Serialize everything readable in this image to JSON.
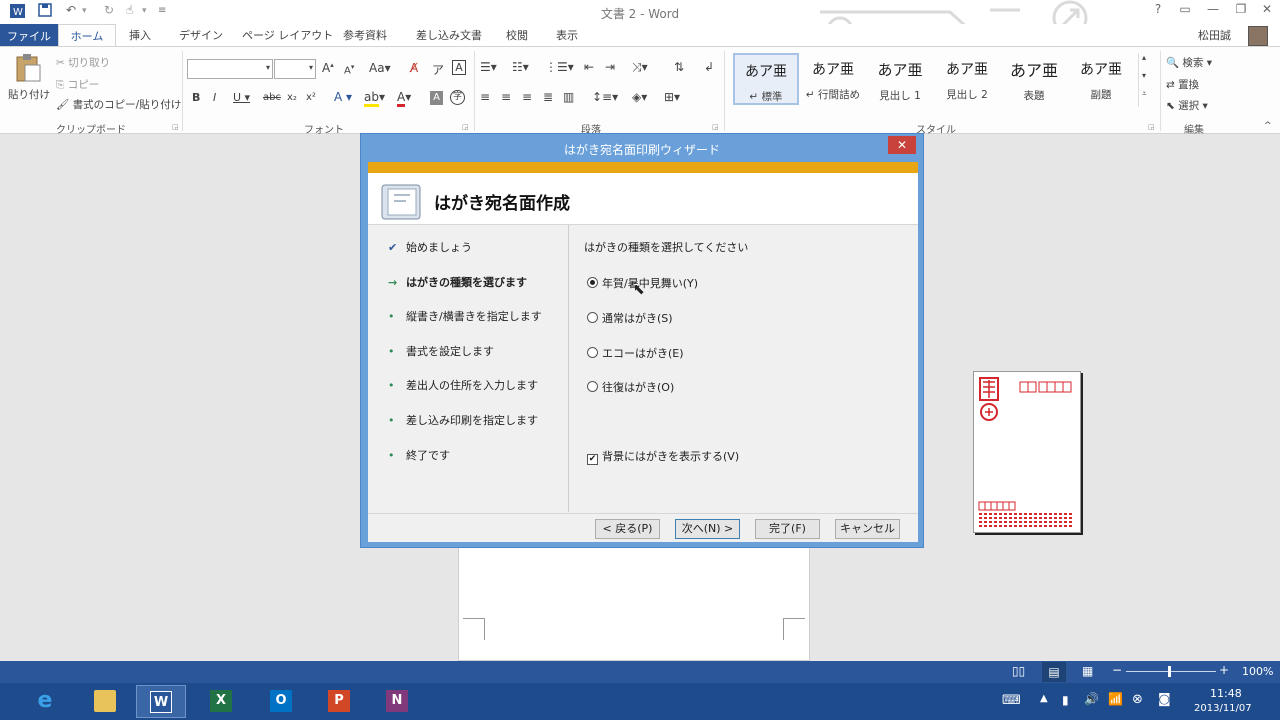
{
  "app": {
    "doc_title": "文書 2 - Word",
    "user_name": "松田誠",
    "title_help": "?"
  },
  "tabs": [
    "ファイル",
    "ホーム",
    "挿入",
    "デザイン",
    "ページ レイアウト",
    "参考資料",
    "差し込み文書",
    "校閲",
    "表示"
  ],
  "ribbon": {
    "clipboard": {
      "paste": "貼り付け",
      "cut": "切り取り",
      "copy": "コピー",
      "format_painter": "書式のコピー/貼り付け",
      "label": "クリップボード"
    },
    "font": {
      "label": "フォント",
      "font_name": "",
      "font_size": ""
    },
    "paragraph": {
      "label": "段落"
    },
    "styles": {
      "label": "スタイル",
      "items": [
        {
          "sample": "あア亜",
          "name": "↵ 標準"
        },
        {
          "sample": "あア亜",
          "name": "↵ 行間詰め"
        },
        {
          "sample": "あア亜",
          "name": "見出し 1"
        },
        {
          "sample": "あア亜",
          "name": "見出し 2"
        },
        {
          "sample": "あア亜",
          "name": "表題"
        },
        {
          "sample": "あア亜",
          "name": "副題"
        }
      ]
    },
    "editing": {
      "label": "編集",
      "find": "検索",
      "replace": "置換",
      "select": "選択"
    }
  },
  "dialog": {
    "title": "はがき宛名面印刷ウィザード",
    "header_title": "はがき宛名面作成",
    "steps": [
      {
        "label": "始めましょう",
        "state": "done"
      },
      {
        "label": "はがきの種類を選びます",
        "state": "current"
      },
      {
        "label": "縦書き/横書きを指定します",
        "state": "todo"
      },
      {
        "label": "書式を設定します",
        "state": "todo"
      },
      {
        "label": "差出人の住所を入力します",
        "state": "todo"
      },
      {
        "label": "差し込み印刷を指定します",
        "state": "todo"
      },
      {
        "label": "終了です",
        "state": "todo"
      }
    ],
    "prompt": "はがきの種類を選択してください",
    "options": [
      {
        "label": "年賀/暑中見舞い(Y)",
        "selected": true
      },
      {
        "label": "通常はがき(S)",
        "selected": false
      },
      {
        "label": "エコーはがき(E)",
        "selected": false
      },
      {
        "label": "往復はがき(O)",
        "selected": false
      }
    ],
    "show_background": {
      "label": "背景にはがきを表示する(V)",
      "checked": true
    },
    "buttons": {
      "back": "< 戻る(P)",
      "next": "次へ(N) >",
      "finish": "完了(F)",
      "cancel": "キャンセル"
    }
  },
  "statusbar": {
    "zoom": "100%"
  },
  "taskbar": {
    "time": "11:48",
    "date": "2013/11/07"
  },
  "colors": {
    "word_blue": "#2b579a",
    "dialog_frame": "#6aa0da",
    "wizard_accent": "#e8a615",
    "close_red": "#c7433c",
    "postcard_red": "#d4262c"
  }
}
